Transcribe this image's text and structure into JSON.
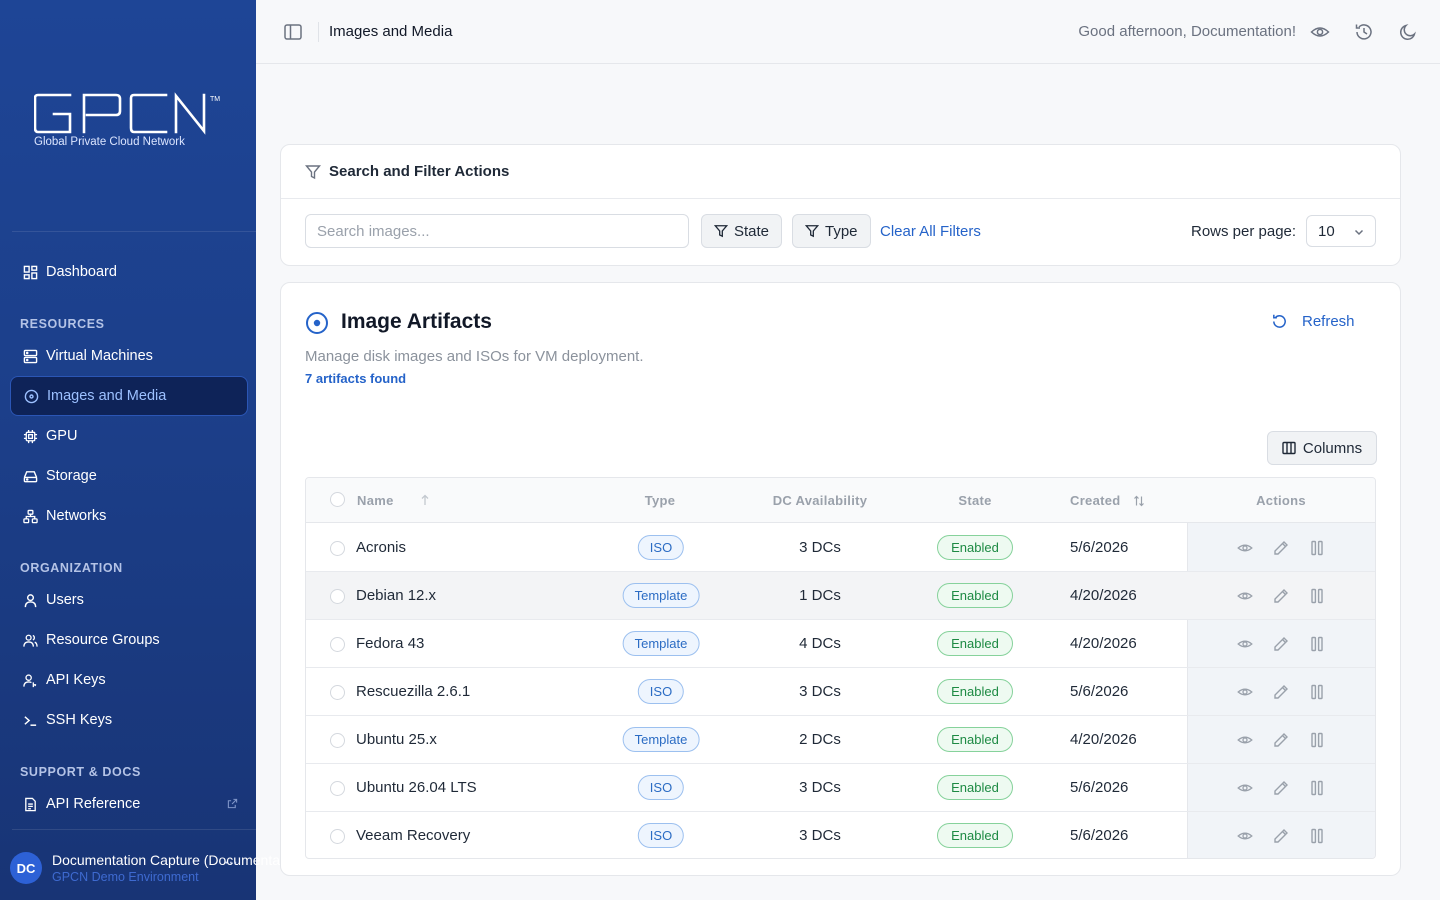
{
  "sidebar": {
    "logo_text": "GPCN",
    "logo_tm": "TM",
    "logo_subtitle": "Global Private Cloud Network",
    "dashboard": {
      "label": "Dashboard",
      "icon": "dashboard-icon"
    },
    "sections": [
      {
        "title": "RESOURCES",
        "items": [
          {
            "label": "Virtual Machines",
            "icon": "server-icon"
          },
          {
            "label": "Images and Media",
            "icon": "disc-icon",
            "active": true
          },
          {
            "label": "GPU",
            "icon": "chip-icon"
          },
          {
            "label": "Storage",
            "icon": "hard-drive-icon"
          },
          {
            "label": "Networks",
            "icon": "network-icon"
          }
        ]
      },
      {
        "title": "ORGANIZATION",
        "items": [
          {
            "label": "Users",
            "icon": "user-icon"
          },
          {
            "label": "Resource Groups",
            "icon": "users-icon"
          },
          {
            "label": "API Keys",
            "icon": "user-key-icon"
          },
          {
            "label": "SSH Keys",
            "icon": "terminal-icon"
          }
        ]
      },
      {
        "title": "SUPPORT & DOCS",
        "items": [
          {
            "label": "API Reference",
            "icon": "document-icon",
            "external": true
          }
        ]
      }
    ],
    "user": {
      "initials": "DC",
      "name": "Documentation Capture (Documentation)",
      "environment": "GPCN Demo Environment",
      "more": "⋯"
    }
  },
  "header": {
    "title": "Images and Media",
    "greeting": "Good afternoon, Documentation!"
  },
  "filters": {
    "title": "Search and Filter Actions",
    "search_placeholder": "Search images...",
    "state_label": "State",
    "type_label": "Type",
    "clear_label": "Clear All Filters",
    "rows_per_page_label": "Rows per page:",
    "rows_per_page_value": "10"
  },
  "artifacts": {
    "title": "Image Artifacts",
    "description": "Manage disk images and ISOs for VM deployment.",
    "count_text": "7 artifacts found",
    "refresh_label": "Refresh",
    "columns_label": "Columns",
    "headers": {
      "name": "Name",
      "type": "Type",
      "dc": "DC Availability",
      "state": "State",
      "created": "Created",
      "actions": "Actions"
    },
    "rows": [
      {
        "name": "Acronis",
        "type": "ISO",
        "dc": "3 DCs",
        "state": "Enabled",
        "created": "5/6/2026"
      },
      {
        "name": "Debian 12.x",
        "type": "Template",
        "dc": "1 DCs",
        "state": "Enabled",
        "created": "4/20/2026",
        "highlighted": true
      },
      {
        "name": "Fedora 43",
        "type": "Template",
        "dc": "4 DCs",
        "state": "Enabled",
        "created": "4/20/2026"
      },
      {
        "name": "Rescuezilla 2.6.1",
        "type": "ISO",
        "dc": "3 DCs",
        "state": "Enabled",
        "created": "5/6/2026"
      },
      {
        "name": "Ubuntu 25.x",
        "type": "Template",
        "dc": "2 DCs",
        "state": "Enabled",
        "created": "4/20/2026"
      },
      {
        "name": "Ubuntu 26.04 LTS",
        "type": "ISO",
        "dc": "3 DCs",
        "state": "Enabled",
        "created": "5/6/2026"
      },
      {
        "name": "Veeam Recovery",
        "type": "ISO",
        "dc": "3 DCs",
        "state": "Enabled",
        "created": "5/6/2026"
      }
    ]
  },
  "colors": {
    "sidebar_top": "#1e4596",
    "sidebar_bottom": "#183475",
    "accent": "#2563c9",
    "enabled_green": "#1d8a43"
  }
}
